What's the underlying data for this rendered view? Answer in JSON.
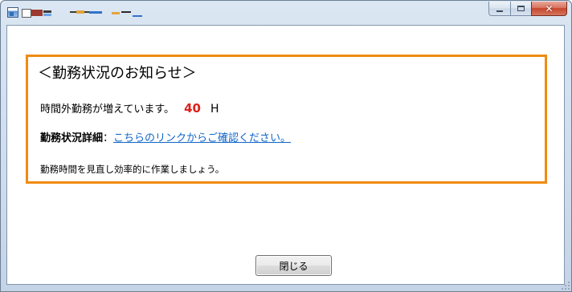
{
  "window": {
    "minimize_label": "",
    "maximize_label": "",
    "close_glyph": "✕",
    "title_icons": [
      "app-window-icon"
    ]
  },
  "notice": {
    "title": "＜勤務状況のお知らせ＞",
    "overtime_text": "時間外勤務が増えています。",
    "overtime_hours": "40",
    "overtime_unit": "H",
    "detail_label": "勤務状況詳細",
    "detail_separator": "：",
    "detail_link": "こちらのリンクからご確認ください。",
    "advice": "勤務時間を見直し効率的に作業しましょう。"
  },
  "buttons": {
    "close_label": "閉じる"
  },
  "colors": {
    "accent_border": "#f08a12",
    "hours_red": "#e0201a",
    "link_blue": "#1066c8"
  }
}
